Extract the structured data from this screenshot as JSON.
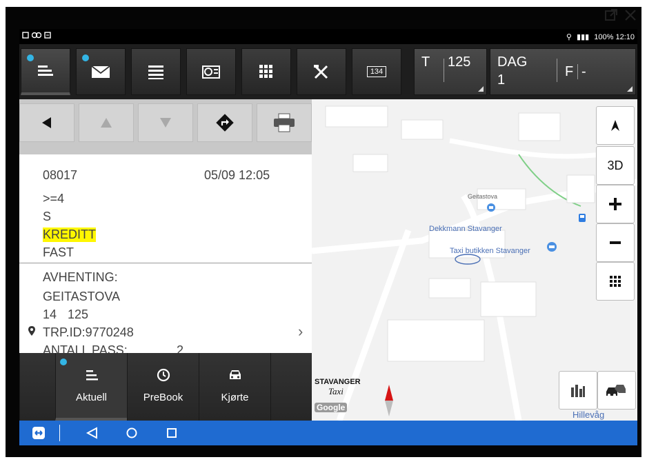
{
  "window": {
    "popout_icon": "external-window-icon",
    "close_icon": "close-icon"
  },
  "status": {
    "right_text": "100% 12:10"
  },
  "toolbar": {
    "t_label": "T",
    "t_value": "125",
    "dag_label": "DAG",
    "dag_value": "1",
    "f_label": "F",
    "f_value": "-",
    "counter_badge": "134"
  },
  "job": {
    "id": "08017",
    "datetime": "05/09 12:05",
    "line_pass": ">=4",
    "line_s": "S",
    "payment": "KREDITT",
    "fare": "FAST",
    "pickup_label": "AVHENTING:",
    "pickup_place": "GEITASTOVA",
    "pickup_num": "14",
    "pickup_code": "125",
    "trip_id": "TRP.ID:9770248",
    "pass_label": "ANTALL PASS:",
    "pass_count": "2"
  },
  "bottom_nav": [
    {
      "label": "Aktuell"
    },
    {
      "label": "PreBook"
    },
    {
      "label": "Kjørte"
    }
  ],
  "map": {
    "btn_3d": "3D",
    "poi_geitastova": "Geitastova",
    "poi_dekkmann": "Dekkmann Stavanger",
    "poi_taxi": "Taxi butikken Stavanger",
    "area_label": "Hillevåg",
    "brand_top": "STAVANGER",
    "brand_mid": "Taxi",
    "google": "Google"
  },
  "colors": {
    "accent_dot": "#33b5e5",
    "highlight": "#fff700",
    "nav_blue": "#1f6bd1"
  }
}
